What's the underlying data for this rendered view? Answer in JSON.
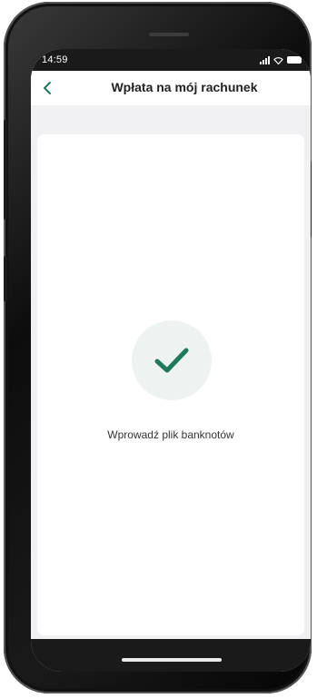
{
  "status_bar": {
    "time": "14:59"
  },
  "header": {
    "title": "Wpłata na mój rachunek",
    "back_icon": "chevron-left-icon"
  },
  "content": {
    "status_icon": "checkmark-icon",
    "message": "Wprowadź plik banknotów"
  },
  "colors": {
    "accent": "#1f7a5c",
    "check_circle_bg": "#eef2f0",
    "screen_bg": "#f1f1f3",
    "card_bg": "#ffffff"
  }
}
